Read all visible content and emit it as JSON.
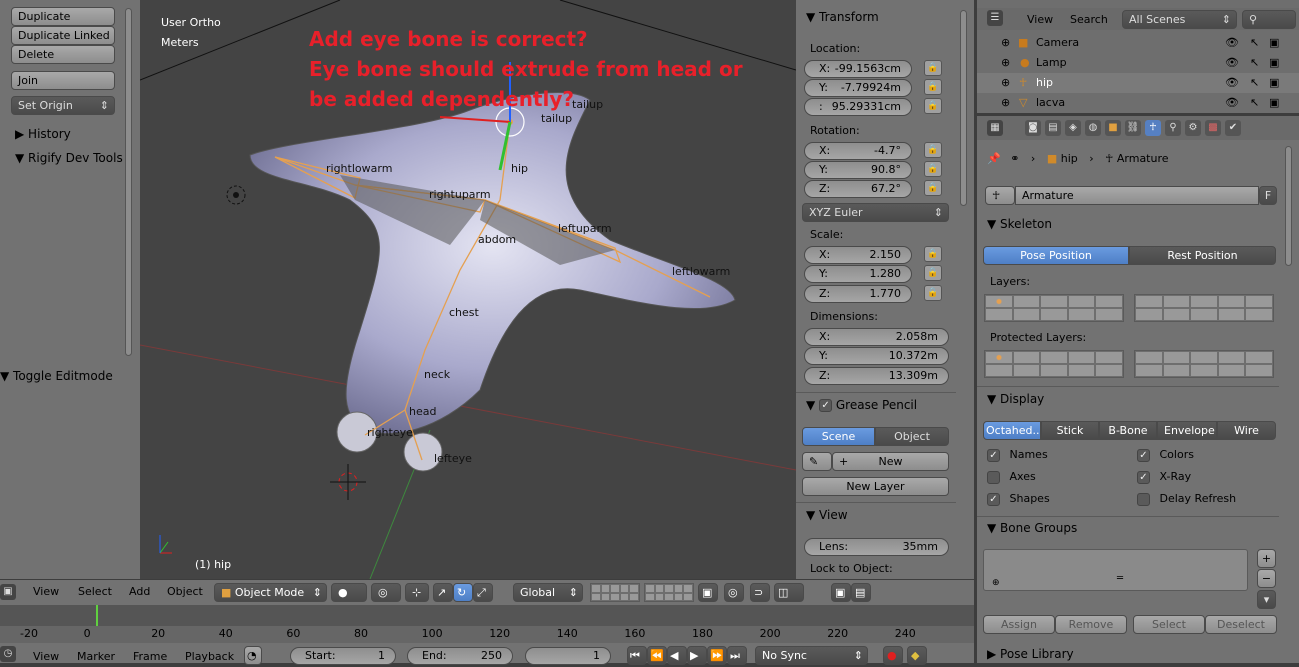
{
  "toolshelf": {
    "buttons": [
      "Duplicate",
      "Duplicate Linked",
      "Delete",
      "Join",
      "Set Origin"
    ],
    "history": "History",
    "rigify": "Rigify Dev Tools",
    "operator": "Toggle Editmode"
  },
  "viewport": {
    "view_name": "User Ortho",
    "units": "Meters",
    "object_label": "(1) hip",
    "annotation_lines": [
      "Add eye bone is correct?",
      "Eye bone should extrude from head or",
      "be added dependently?"
    ],
    "bones": [
      "tailup",
      "tailup",
      "hip",
      "rightlowarm",
      "rightuparm",
      "leftuparm",
      "abdom",
      "leftlowarm",
      "chest",
      "neck",
      "head",
      "righteye",
      "lefteye"
    ]
  },
  "transform": {
    "title": "Transform",
    "location_label": "Location:",
    "location": [
      {
        "axis": "X:",
        "value": "-99.1563cm"
      },
      {
        "axis": "Y:",
        "value": "-7.79924m"
      },
      {
        "axis": ":",
        "value": "95.29331cm"
      }
    ],
    "rotation_label": "Rotation:",
    "rotation": [
      {
        "axis": "X:",
        "value": "-4.7°"
      },
      {
        "axis": "Y:",
        "value": "90.8°"
      },
      {
        "axis": "Z:",
        "value": "67.2°"
      }
    ],
    "rotation_mode": "XYZ Euler",
    "scale_label": "Scale:",
    "scale": [
      {
        "axis": "X:",
        "value": "2.150"
      },
      {
        "axis": "Y:",
        "value": "1.280"
      },
      {
        "axis": "Z:",
        "value": "1.770"
      }
    ],
    "dimensions_label": "Dimensions:",
    "dimensions": [
      {
        "axis": "X:",
        "value": "2.058m"
      },
      {
        "axis": "Y:",
        "value": "10.372m"
      },
      {
        "axis": "Z:",
        "value": "13.309m"
      }
    ]
  },
  "grease_pencil": {
    "title": "Grease Pencil",
    "scene": "Scene",
    "object": "Object",
    "new": "New",
    "new_layer": "New Layer"
  },
  "view_panel": {
    "title": "View",
    "lens_label": "Lens:",
    "lens": "35mm",
    "lock": "Lock to Object:"
  },
  "outliner": {
    "view": "View",
    "search": "Search",
    "scenes": "All Scenes",
    "items": [
      "Camera",
      "Lamp",
      "hip",
      "lacva"
    ]
  },
  "properties": {
    "breadcrumb_obj": "hip",
    "breadcrumb_data": "Armature",
    "datablock": "Armature",
    "f_btn": "F",
    "skeleton": "Skeleton",
    "pose_position": "Pose Position",
    "rest_position": "Rest Position",
    "layers": "Layers:",
    "protected_layers": "Protected Layers:",
    "display": "Display",
    "display_modes": [
      "Octahed...",
      "Stick",
      "B-Bone",
      "Envelope",
      "Wire"
    ],
    "options_left": [
      {
        "label": "Names",
        "checked": true
      },
      {
        "label": "Axes",
        "checked": false
      },
      {
        "label": "Shapes",
        "checked": true
      }
    ],
    "options_right": [
      {
        "label": "Colors",
        "checked": true
      },
      {
        "label": "X-Ray",
        "checked": true
      },
      {
        "label": "Delay Refresh",
        "checked": false
      }
    ],
    "bone_groups": "Bone Groups",
    "group_buttons": [
      "Assign",
      "Remove",
      "Select",
      "Deselect"
    ],
    "pose_library": "Pose Library"
  },
  "view3d_header": {
    "menus": [
      "View",
      "Select",
      "Add",
      "Object"
    ],
    "mode": "Object Mode",
    "orientation": "Global"
  },
  "timeline": {
    "ticks": [
      "-20",
      "0",
      "20",
      "40",
      "60",
      "80",
      "100",
      "120",
      "140",
      "160",
      "180",
      "200",
      "220",
      "240"
    ],
    "menus": [
      "View",
      "Marker",
      "Frame",
      "Playback"
    ],
    "start_label": "Start:",
    "start": "1",
    "end_label": "End:",
    "end": "250",
    "current": "1",
    "sync": "No Sync"
  },
  "colors": {
    "annotation": "#e8202a",
    "accent": "#5680c2"
  }
}
